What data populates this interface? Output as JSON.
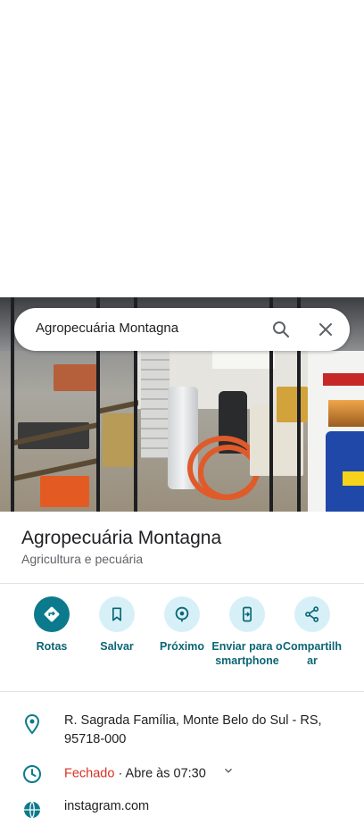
{
  "search": {
    "query": "Agropecuária Montagna",
    "search_icon": "search-icon",
    "close_icon": "close-icon"
  },
  "place": {
    "title": "Agropecuária Montagna",
    "category": "Agricultura e pecuária"
  },
  "actions": [
    {
      "label": "Rotas",
      "icon": "directions-icon"
    },
    {
      "label": "Salvar",
      "icon": "bookmark-icon"
    },
    {
      "label": "Próximo",
      "icon": "nearby-icon"
    },
    {
      "label": "Enviar para o smartphone",
      "icon": "send-to-phone-icon"
    },
    {
      "label": "Compartilhar",
      "icon": "share-icon"
    }
  ],
  "info": {
    "address": "R. Sagrada Família, Monte Belo do Sul - RS, 95718-000",
    "hours_status": "Fechado",
    "hours_detail": " · Abre às 07:30",
    "website": "instagram.com"
  },
  "colors": {
    "accent": "#0b7a8c",
    "accent_light": "#d7f0f8",
    "closed_red": "#d93025"
  }
}
